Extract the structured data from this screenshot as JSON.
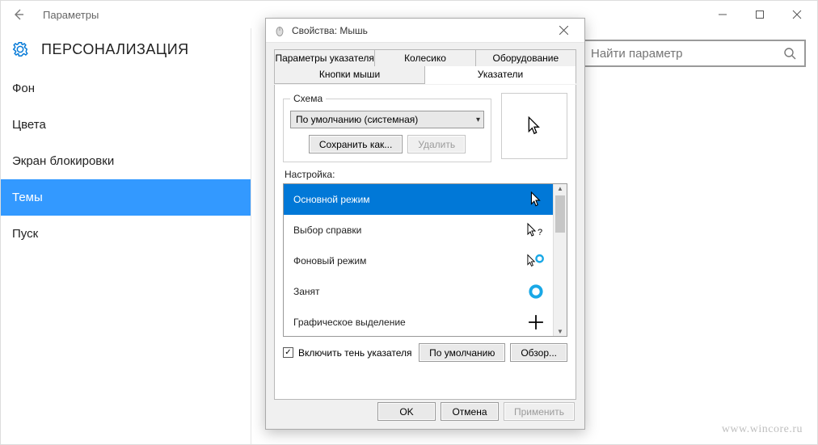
{
  "settings": {
    "window_title": "Параметры",
    "section_title": "ПЕРСОНАЛИЗАЦИЯ",
    "search_placeholder": "Найти параметр",
    "nav": [
      {
        "label": "Фон"
      },
      {
        "label": "Цвета"
      },
      {
        "label": "Экран блокировки"
      },
      {
        "label": "Темы",
        "selected": true
      },
      {
        "label": "Пуск"
      }
    ]
  },
  "dialog": {
    "title": "Свойства: Мышь",
    "tabs_top": [
      "Параметры указателя",
      "Колесико",
      "Оборудование"
    ],
    "tabs_bottom": [
      "Кнопки мыши",
      "Указатели"
    ],
    "active_tab": "Указатели",
    "scheme": {
      "legend": "Схема",
      "selected": "По умолчанию (системная)",
      "save_as": "Сохранить как...",
      "delete": "Удалить"
    },
    "customize_label": "Настройка:",
    "cursor_items": [
      {
        "label": "Основной режим",
        "icon": "cursor-arrow",
        "selected": true
      },
      {
        "label": "Выбор справки",
        "icon": "cursor-help"
      },
      {
        "label": "Фоновый режим",
        "icon": "cursor-working"
      },
      {
        "label": "Занят",
        "icon": "cursor-busy"
      },
      {
        "label": "Графическое выделение",
        "icon": "cursor-cross"
      }
    ],
    "shadow_checkbox": "Включить тень указателя",
    "default_btn": "По умолчанию",
    "browse_btn": "Обзор...",
    "ok": "OK",
    "cancel": "Отмена",
    "apply": "Применить"
  },
  "watermark": "www.wincore.ru"
}
